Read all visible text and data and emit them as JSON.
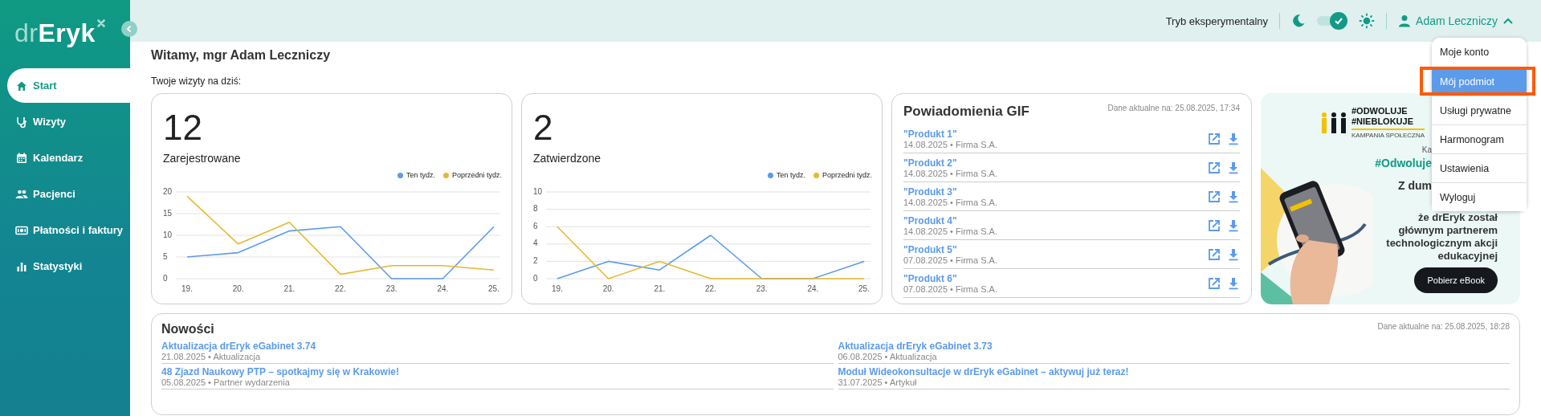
{
  "sidebar": {
    "logo": {
      "prefix": "dr",
      "name": "Eryk"
    },
    "items": [
      {
        "label": "Start",
        "selected": true
      },
      {
        "label": "Wizyty",
        "selected": false
      },
      {
        "label": "Kalendarz",
        "selected": false
      },
      {
        "label": "Pacjenci",
        "selected": false
      },
      {
        "label": "Płatności i faktury",
        "selected": false
      },
      {
        "label": "Statystyki",
        "selected": false
      }
    ]
  },
  "header": {
    "experimental_label": "Tryb eksperymentalny",
    "theme_toggle": {
      "on": true
    },
    "user": {
      "name": "Adam Leczniczy",
      "expanded": true
    }
  },
  "user_menu": {
    "items": [
      {
        "label": "Moje konto",
        "selected": false
      },
      {
        "label": "Mój podmiot",
        "selected": true
      },
      {
        "label": "Usługi prywatne",
        "selected": false
      },
      {
        "label": "Harmonogram",
        "selected": false
      },
      {
        "label": "Ustawienia",
        "selected": false
      },
      {
        "label": "Wyloguj",
        "selected": false
      }
    ]
  },
  "welcome": {
    "title": "Witamy, mgr Adam Leczniczy",
    "subtitle": "Twoje wizyty na dziś:"
  },
  "stats": [
    {
      "count": "12",
      "label": "Zarejestrowane",
      "chart_data": {
        "type": "line",
        "grid": true,
        "categories": [
          "19.",
          "20.",
          "21.",
          "22.",
          "23.",
          "24.",
          "25."
        ],
        "ylim": [
          0,
          20
        ],
        "yticks": [
          0,
          5,
          10,
          15,
          20
        ],
        "series": [
          {
            "name": "Ten tydz.",
            "color": "#5b9bea",
            "values": [
              5,
              6,
              11,
              12,
              0,
              0,
              12
            ]
          },
          {
            "name": "Poprzedni tydz.",
            "color": "#e5b830",
            "values": [
              19,
              8,
              13,
              1,
              3,
              3,
              2
            ]
          }
        ]
      }
    },
    {
      "count": "2",
      "label": "Zatwierdzone",
      "chart_data": {
        "type": "line",
        "grid": true,
        "categories": [
          "19.",
          "20.",
          "21.",
          "22.",
          "23.",
          "24.",
          "25."
        ],
        "ylim": [
          0,
          10
        ],
        "yticks": [
          0,
          2,
          4,
          6,
          8,
          10
        ],
        "series": [
          {
            "name": "Ten tydz.",
            "color": "#5b9bea",
            "values": [
              0,
              2,
              1,
              5,
              0,
              0,
              2
            ]
          },
          {
            "name": "Poprzedni tydz.",
            "color": "#e5b830",
            "values": [
              6,
              0,
              2,
              0,
              0,
              0,
              0
            ]
          }
        ]
      }
    }
  ],
  "notifications": {
    "title": "Powiadomienia GIF",
    "updated": "Dane aktualne na: 25.08.2025, 17:34",
    "items": [
      {
        "title": "\"Produkt 1\"",
        "meta": "14.08.2025 • Firma S.A."
      },
      {
        "title": "\"Produkt 2\"",
        "meta": "14.08.2025 • Firma S.A."
      },
      {
        "title": "\"Produkt 3\"",
        "meta": "14.08.2025 • Firma S.A."
      },
      {
        "title": "\"Produkt 4\"",
        "meta": "14.08.2025 • Firma S.A."
      },
      {
        "title": "\"Produkt 5\"",
        "meta": "07.08.2025 • Firma S.A."
      },
      {
        "title": "\"Produkt 6\"",
        "meta": "07.08.2025 • Firma S.A."
      }
    ]
  },
  "banner": {
    "hashtags": [
      "#ODWOLUJE",
      "#NIEBLOKUJE"
    ],
    "campaign": "KAMPANIA SPOŁECZNA",
    "partial_lines": [
      "Ka",
      "#Odwoluje",
      "Z dum"
    ],
    "lines": [
      "że drEryk został",
      "głównym partnerem",
      "technologicznym akcji",
      "edukacyjnej"
    ],
    "button": "Pobierz eBook"
  },
  "news": {
    "title": "Nowości",
    "updated": "Dane aktualne na: 25.08.2025, 18:28",
    "items": [
      {
        "title": "Aktualizacja drEryk eGabinet 3.74",
        "meta": "21.08.2025 • Aktualizacja"
      },
      {
        "title": "Aktualizacja drEryk eGabinet 3.73",
        "meta": "06.08.2025 • Aktualizacja"
      },
      {
        "title": "48 Zjazd Naukowy PTP – spotkajmy się w Krakowie!",
        "meta": "05.08.2025 • Partner wydarzenia"
      },
      {
        "title": "Moduł Wideokonsultacje w drEryk eGabinet – aktywuj już teraz!",
        "meta": "31.07.2025 • Artykuł"
      }
    ]
  }
}
